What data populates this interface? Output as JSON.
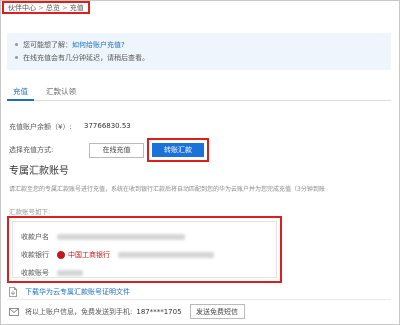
{
  "breadcrumb": {
    "items": [
      "伙伴中心",
      "总览",
      "充值"
    ],
    "separator": ">"
  },
  "notice": {
    "line1_prefix": "您可能想了解：",
    "line1_link": "如何给账户充值?",
    "line2": "在线充值会有几分钟延迟，请稍后查看。"
  },
  "tabs": [
    {
      "label": "充值",
      "active": true
    },
    {
      "label": "汇款认领",
      "active": false
    }
  ],
  "balance": {
    "label": "充值账户余额（¥）:",
    "value": "37766830.53"
  },
  "method": {
    "label": "选择充值方式:",
    "online_label": "在线充值",
    "wire_label": "转账汇款"
  },
  "section_title": "专属汇款账号",
  "description": "请汇款至您的专属汇款账号进行充值，系统在收到银行汇款后将自动匹配到您的华为云账户并为您完成充值（3分钟到账",
  "account_info": {
    "title": "汇款账号如下:",
    "name_label": "收款户名",
    "bank_label": "收款银行",
    "bank_name": "中国工商银行",
    "account_label": "收款账号"
  },
  "download": {
    "link": "下载华为云专属汇款账号证明文件"
  },
  "sms": {
    "text": "将以上账户信息，免费发送到手机:",
    "phone": "187****1705",
    "button_label": "发送免费短信"
  },
  "colors": {
    "accent": "#1a73d9",
    "link": "#1a6dc4",
    "highlight": "#d9201f",
    "notice_bg": "#eef5fc"
  }
}
